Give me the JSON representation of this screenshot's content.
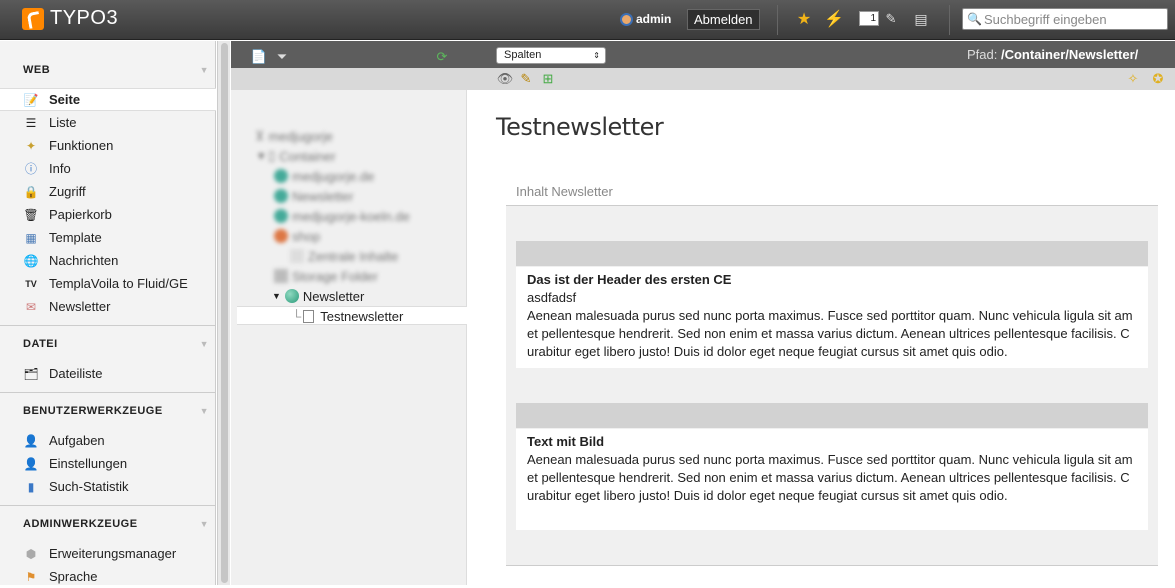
{
  "topbar": {
    "logo": "TYPO3",
    "user": "admin",
    "logout": "Abmelden",
    "workspace_count": "1",
    "search_placeholder": "Suchbegriff eingeben"
  },
  "module_menu": {
    "groups": [
      {
        "title": "WEB",
        "items": [
          {
            "label": "Seite",
            "icon": "page-icon",
            "active": true
          },
          {
            "label": "Liste",
            "icon": "list-icon"
          },
          {
            "label": "Funktionen",
            "icon": "wand-icon"
          },
          {
            "label": "Info",
            "icon": "info-icon"
          },
          {
            "label": "Zugriff",
            "icon": "lock-icon"
          },
          {
            "label": "Papierkorb",
            "icon": "trash-icon"
          },
          {
            "label": "Template",
            "icon": "template-icon"
          },
          {
            "label": "Nachrichten",
            "icon": "news-icon"
          },
          {
            "label": "TemplaVoila to Fluid/GE",
            "icon": "tv-icon"
          },
          {
            "label": "Newsletter",
            "icon": "newsletter-icon"
          }
        ]
      },
      {
        "title": "DATEI",
        "items": [
          {
            "label": "Dateiliste",
            "icon": "filelist-icon"
          }
        ]
      },
      {
        "title": "BENUTZERWERKZEUGE",
        "items": [
          {
            "label": "Aufgaben",
            "icon": "tasks-icon"
          },
          {
            "label": "Einstellungen",
            "icon": "settings-icon"
          },
          {
            "label": "Such-Statistik",
            "icon": "stats-icon"
          }
        ]
      },
      {
        "title": "ADMINWERKZEUGE",
        "items": [
          {
            "label": "Erweiterungsmanager",
            "icon": "extension-icon"
          },
          {
            "label": "Sprache",
            "icon": "language-icon"
          }
        ]
      }
    ]
  },
  "docheader": {
    "view_select": "Spalten",
    "path_label": "Pfad:",
    "path_value": "/Container/Newsletter/"
  },
  "tree": {
    "root": "medjugorje",
    "container": "Container",
    "items": [
      "medjugorje.de",
      "Newsletter",
      "medjugorje-koeln.de",
      "shop",
      "Zentrale Inhalte",
      "Storage Folder"
    ],
    "expanded": "Newsletter",
    "selected": "Testnewsletter"
  },
  "content": {
    "title": "Testnewsletter",
    "section": "Inhalt Newsletter",
    "ce1": {
      "header": "Das ist der Header des ersten CE",
      "sub": "asdfadsf",
      "body": "Aenean malesuada purus sed nunc porta maximus. Fusce sed porttitor quam. Nunc vehicula ligula sit amet pellentesque hendrerit. Sed non enim et massa varius dictum. Aenean ultrices pellentesque facilisis. Curabitur eget libero justo! Duis id dolor eget neque feugiat cursus sit amet quis odio."
    },
    "ce2": {
      "header": "Text mit Bild",
      "body": "Aenean malesuada purus sed nunc porta maximus. Fusce sed porttitor quam. Nunc vehicula ligula sit amet pellentesque hendrerit. Sed non enim et massa varius dictum. Aenean ultrices pellentesque facilisis. Curabitur eget libero justo! Duis id dolor eget neque feugiat cursus sit amet quis odio."
    }
  }
}
